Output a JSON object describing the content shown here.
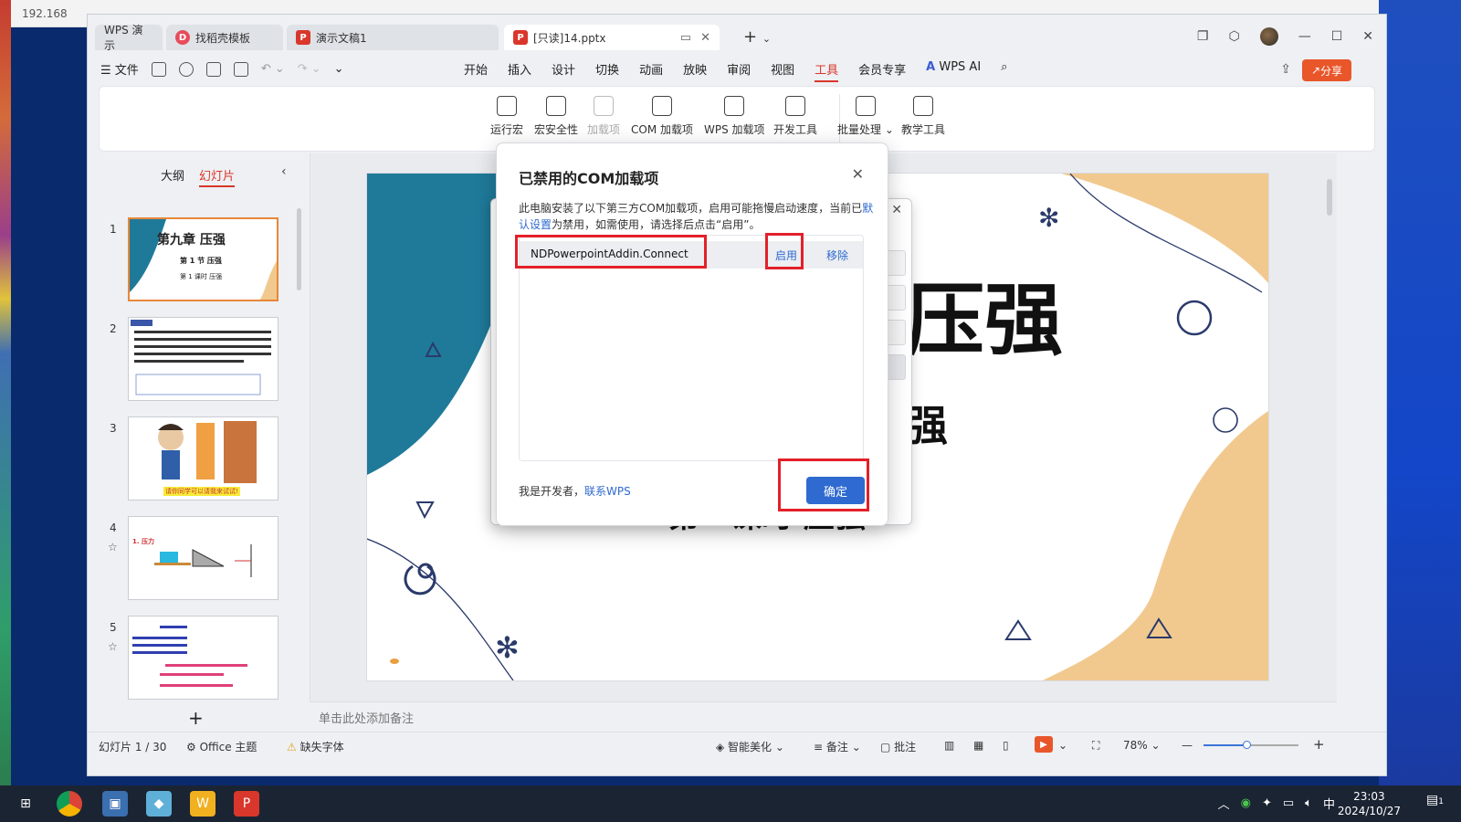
{
  "remote": {
    "ip": "192.168"
  },
  "tabs": [
    {
      "label": "WPS 演示"
    },
    {
      "label": "找稻壳模板"
    },
    {
      "label": "演示文稿1"
    },
    {
      "label": "[只读]14.pptx"
    }
  ],
  "menu": {
    "file": "文件",
    "items": [
      "开始",
      "插入",
      "设计",
      "切换",
      "动画",
      "放映",
      "审阅",
      "视图",
      "工具",
      "会员专享"
    ],
    "active": "工具",
    "wps_ai": "WPS AI",
    "share": "分享"
  },
  "ribbon": {
    "tools": [
      "运行宏",
      "宏安全性",
      "加载项",
      "COM 加载项",
      "WPS 加载项",
      "开发工具",
      "批量处理",
      "教学工具"
    ]
  },
  "left_panel": {
    "outline_tab": "大纲",
    "slides_tab": "幻灯片",
    "slide_numbers": [
      "1",
      "2",
      "3",
      "4",
      "5"
    ],
    "thumb1": {
      "title": "第九章  压强",
      "sub": "第 1 节  压强",
      "sub2": "第 1 课时  压强"
    },
    "thumb3_caption": "请你同学可以请我来试试!",
    "thumb4_label": "1. 压力"
  },
  "slide": {
    "big_title": "压强",
    "sub": "强",
    "sub2": "第一课时  压强"
  },
  "notes_placeholder": "单击此处添加备注",
  "status": {
    "slide_count": "幻灯片 1 / 30",
    "theme": "Office 主题",
    "missing_font": "缺失字体",
    "beautify": "智能美化",
    "notes": "备注",
    "comments": "批注",
    "zoom": "78%",
    "zoom_level": 0.45
  },
  "dialog": {
    "title": "已禁用的COM加载项",
    "desc_part1": "此电脑安装了以下第三方COM加载项，启用可能拖慢启动速度，当前已",
    "desc_link": "默认设置",
    "desc_part2": "为禁用，如需使用，请选择后点击“启用”。",
    "addin_name": "NDPowerpointAddin.Connect",
    "enable": "启用",
    "remove": "移除",
    "developer_text": "我是开发者，",
    "contact_link": "联系WPS",
    "ok": "确定"
  },
  "taskbar": {
    "time": "23:03",
    "date": "2024/10/27",
    "ime": "中",
    "notif_count": "1"
  },
  "colors": {
    "accent_red": "#d9372b",
    "link_blue": "#2f6ad0",
    "highlight_red": "#e3202a",
    "slide_teal": "#1f7a9a",
    "slide_tan": "#f1c98f"
  }
}
